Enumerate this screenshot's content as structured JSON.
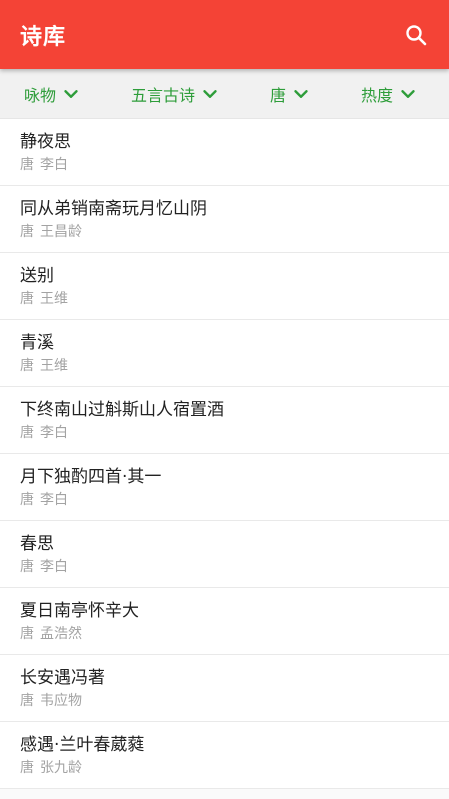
{
  "app": {
    "title": "诗库",
    "colors": {
      "primary": "#f44336",
      "accent": "#2e9d3a",
      "filter_bg": "#f1f1f1"
    },
    "search_icon": "search-icon"
  },
  "filters": [
    {
      "label": "咏物"
    },
    {
      "label": "五言古诗"
    },
    {
      "label": "唐"
    },
    {
      "label": "热度"
    }
  ],
  "poems": [
    {
      "title": "静夜思",
      "dynasty": "唐",
      "author": "李白"
    },
    {
      "title": "同从弟销南斋玩月忆山阴",
      "dynasty": "唐",
      "author": "王昌龄"
    },
    {
      "title": "送别",
      "dynasty": "唐",
      "author": "王维"
    },
    {
      "title": "青溪",
      "dynasty": "唐",
      "author": "王维"
    },
    {
      "title": "下终南山过斛斯山人宿置酒",
      "dynasty": "唐",
      "author": "李白"
    },
    {
      "title": "月下独酌四首·其一",
      "dynasty": "唐",
      "author": "李白"
    },
    {
      "title": "春思",
      "dynasty": "唐",
      "author": "李白"
    },
    {
      "title": "夏日南亭怀辛大",
      "dynasty": "唐",
      "author": "孟浩然"
    },
    {
      "title": "长安遇冯著",
      "dynasty": "唐",
      "author": "韦应物"
    },
    {
      "title": "感遇·兰叶春葳蕤",
      "dynasty": "唐",
      "author": "张九龄"
    }
  ]
}
